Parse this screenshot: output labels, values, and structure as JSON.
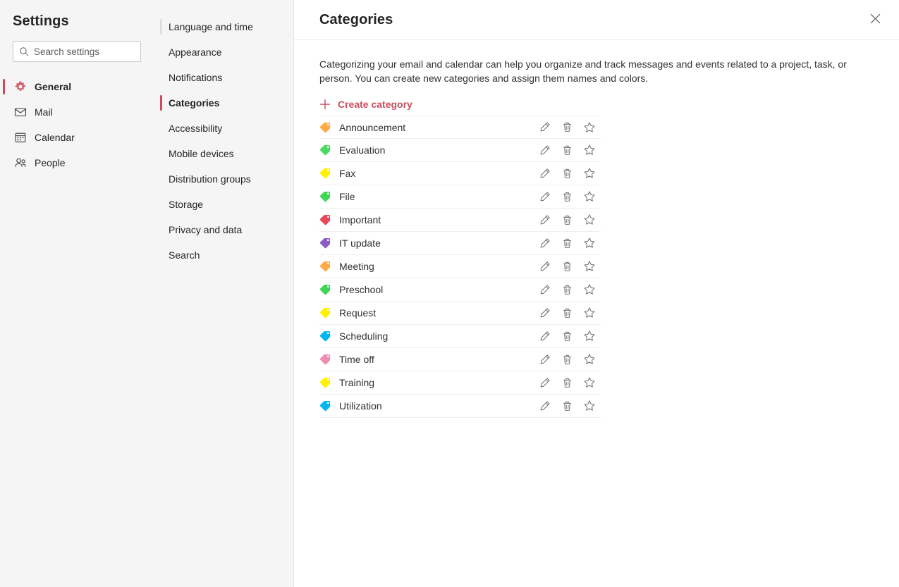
{
  "window": {
    "title": "Settings"
  },
  "search": {
    "placeholder": "Search settings",
    "value": "",
    "icon": "search-icon"
  },
  "primary_nav": {
    "items": [
      {
        "label": "General",
        "icon": "gear-icon",
        "active": true
      },
      {
        "label": "Mail",
        "icon": "mail-icon",
        "active": false
      },
      {
        "label": "Calendar",
        "icon": "calendar-icon",
        "active": false
      },
      {
        "label": "People",
        "icon": "people-icon",
        "active": false
      }
    ]
  },
  "secondary_nav": {
    "items": [
      {
        "label": "Language and time",
        "active": false,
        "marker": true
      },
      {
        "label": "Appearance",
        "active": false,
        "marker": false
      },
      {
        "label": "Notifications",
        "active": false,
        "marker": false
      },
      {
        "label": "Categories",
        "active": true,
        "marker": false
      },
      {
        "label": "Accessibility",
        "active": false,
        "marker": false
      },
      {
        "label": "Mobile devices",
        "active": false,
        "marker": false
      },
      {
        "label": "Distribution groups",
        "active": false,
        "marker": false
      },
      {
        "label": "Storage",
        "active": false,
        "marker": false
      },
      {
        "label": "Privacy and data",
        "active": false,
        "marker": false
      },
      {
        "label": "Search",
        "active": false,
        "marker": false
      }
    ]
  },
  "detail": {
    "title": "Categories",
    "close_icon": "close-icon",
    "description": "Categorizing your email and calendar can help you organize and track messages and events related to a project, task, or person. You can create new categories and assign them names and colors.",
    "create_label": "Create category",
    "create_icon": "plus-icon",
    "row_actions": [
      {
        "name": "edit-category-button",
        "icon": "pencil-icon"
      },
      {
        "name": "delete-category-button",
        "icon": "trash-icon"
      },
      {
        "name": "favorite-category-button",
        "icon": "star-icon"
      }
    ],
    "categories": [
      {
        "name": "Announcement",
        "color": "#ffaa44"
      },
      {
        "name": "Evaluation",
        "color": "#4cd964"
      },
      {
        "name": "Fax",
        "color": "#fff100"
      },
      {
        "name": "File",
        "color": "#3ed654"
      },
      {
        "name": "Important",
        "color": "#e8485a"
      },
      {
        "name": "IT update",
        "color": "#8b5cc7"
      },
      {
        "name": "Meeting",
        "color": "#ffaa44"
      },
      {
        "name": "Preschool",
        "color": "#3ed654"
      },
      {
        "name": "Request",
        "color": "#fff100"
      },
      {
        "name": "Scheduling",
        "color": "#00b7f0"
      },
      {
        "name": "Time off",
        "color": "#f08cb4"
      },
      {
        "name": "Training",
        "color": "#fff100"
      },
      {
        "name": "Utilization",
        "color": "#00b7f0"
      }
    ]
  },
  "colors": {
    "accent_red": "#cc4a5c",
    "link_red": "#c9505f",
    "panel_bg": "#f5f5f5",
    "content_bg": "#ffffff",
    "text": "#252423"
  }
}
